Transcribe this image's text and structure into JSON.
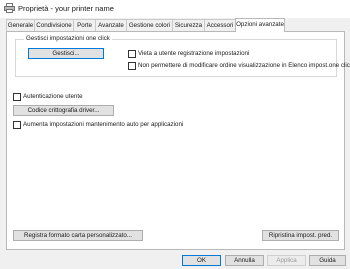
{
  "window": {
    "title": "Proprietà - your printer name",
    "icon": "printer-icon"
  },
  "tabs": [
    {
      "label": "Generale",
      "active": false
    },
    {
      "label": "Condivisione",
      "active": false
    },
    {
      "label": "Porte",
      "active": false
    },
    {
      "label": "Avanzate",
      "active": false
    },
    {
      "label": "Gestione colori",
      "active": false
    },
    {
      "label": "Sicurezza",
      "active": false
    },
    {
      "label": "Accessori",
      "active": false
    },
    {
      "label": "Opzioni avanzate",
      "active": true
    }
  ],
  "one_click": {
    "group_label": "Gestisci impostazioni one click",
    "manage_button": "Gestisci...",
    "checkbox_1": {
      "label": "Vieta a utente registrazione impostazioni",
      "checked": false
    },
    "checkbox_2": {
      "label": "Non permettere di modificare ordine visualizzazione in Elenco impost.one click",
      "checked": false
    }
  },
  "user_auth": {
    "label": "Autenticazione utente",
    "checked": false
  },
  "encryption_button": "Codice crittografia driver...",
  "auto_maintain": {
    "label": "Aumenta impostazioni mantenimento auto per applicazioni",
    "checked": false
  },
  "bottom_buttons": {
    "register_paper": "Registra formato carta personalizzato...",
    "restore_defaults": "Ripristina impost. pred."
  },
  "footer": {
    "ok": "OK",
    "cancel": "Annulla",
    "apply": "Applica",
    "help": "Guida"
  }
}
